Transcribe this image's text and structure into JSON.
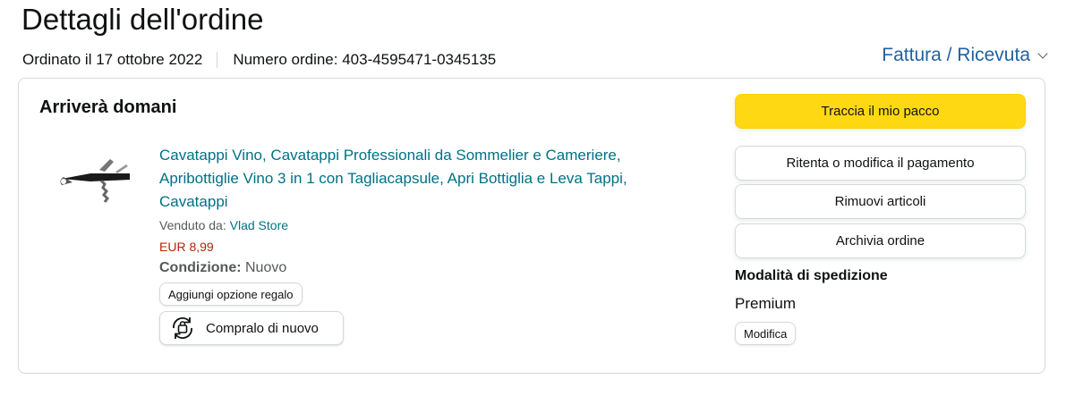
{
  "header": {
    "title": "Dettagli dell'ordine",
    "ordered_on": "Ordinato il 17 ottobre 2022",
    "order_number": "Numero ordine: 403-4595471-0345135",
    "invoice_label": "Fattura / Ricevuta"
  },
  "shipment": {
    "status": "Arriverà domani",
    "item": {
      "title": "Cavatappi Vino, Cavatappi Professionali da Sommelier e Cameriere, Apribottiglie Vino 3 in 1 con Tagliacapsule, Apri Bottiglia e Leva Tappi, Cavatappi",
      "sold_by_label": "Venduto da:",
      "seller": "Vlad Store",
      "price": "EUR 8,99",
      "condition_label": "Condizione:",
      "condition_value": "Nuovo",
      "gift_option_label": "Aggiungi opzione regalo",
      "buy_again_label": "Compralo di nuovo"
    },
    "actions": {
      "track": "Traccia il mio pacco",
      "retry_payment": "Ritenta o modifica il pagamento",
      "remove_items": "Rimuovi articoli",
      "archive": "Archivia ordine"
    },
    "shipping": {
      "title": "Modalità di spedizione",
      "value": "Premium",
      "edit_label": "Modifica"
    }
  },
  "colors": {
    "primary_button": "#ffd814",
    "link": "#007185",
    "price": "#b12704"
  }
}
